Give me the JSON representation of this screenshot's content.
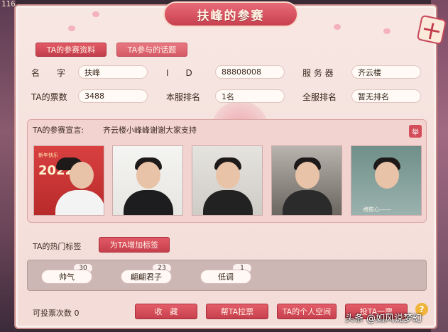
{
  "window": {
    "title": "扶峰的参赛",
    "corner_text": "116",
    "close_symbol": "十"
  },
  "tabs": [
    {
      "label": "TA的参赛资料",
      "active": true
    },
    {
      "label": "TA参与的话题",
      "active": false
    }
  ],
  "profile": {
    "name_label": "名　　字",
    "name_value": "扶峰",
    "id_label": "I　　D",
    "id_value": "88808008",
    "server_label": "服 务 器",
    "server_value": "齐云楼",
    "votes_label": "TA的票数",
    "votes_value": "3488",
    "server_rank_label": "本服排名",
    "server_rank_value": "1名",
    "global_rank_label": "全服排名",
    "global_rank_value": "暂无排名"
  },
  "declaration": {
    "label": "TA的参赛宣言:",
    "text": "齐云楼小峰峰谢谢大家支持",
    "report_label": "举"
  },
  "photos": [
    {
      "caption_year": "2022",
      "caption_small": "新年快乐"
    },
    {},
    {},
    {},
    {
      "signature": "禮筱心——"
    }
  ],
  "tags": {
    "label": "TA的热门标签",
    "add_button": "为TA增加标签",
    "items": [
      {
        "name": "帅气",
        "count": "30"
      },
      {
        "name": "翩翩君子",
        "count": "23"
      },
      {
        "name": "低调",
        "count": "1"
      }
    ]
  },
  "footer": {
    "votes_left_label": "可投票次数",
    "votes_left_value": "0",
    "buttons": [
      "收　藏",
      "帮TA拉票",
      "TA的个人空间",
      "投TA一票"
    ],
    "help_symbol": "?",
    "watermark": "头条 @如风说梦幻"
  },
  "colors": {
    "accent": "#c9404f",
    "panel_bg": "#f7e7e3",
    "field_bg": "#fffaf6"
  }
}
